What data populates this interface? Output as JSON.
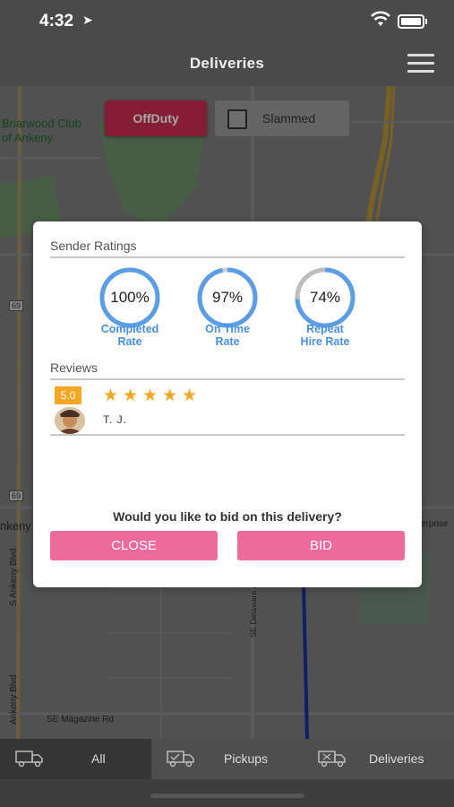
{
  "status": {
    "time": "4:32"
  },
  "header": {
    "title": "Deliveries"
  },
  "map": {
    "labels": {
      "club": "Briarwood Club\nof Ankeny",
      "ankeny": "nkeny",
      "ankeny_blvd_1": "S Ankeny Blvd",
      "ankeny_blvd_2": "Ankeny Blvd",
      "delaware": "SE Delaware Av",
      "magazine": "SE Magazine Rd",
      "enterprise": "erprise",
      "hwy_69_a": "69",
      "hwy_69_b": "69"
    }
  },
  "controls": {
    "offduty_label": "OffDuty",
    "slammed_label": "Slammed"
  },
  "modal": {
    "sender_ratings_title": "Sender Ratings",
    "ratings": [
      {
        "value": 100,
        "label": "100%",
        "caption_1": "Completed",
        "caption_2": "Rate"
      },
      {
        "value": 97,
        "label": "97%",
        "caption_1": "On Time",
        "caption_2": "Rate"
      },
      {
        "value": 74,
        "label": "74%",
        "caption_1": "Repeat",
        "caption_2": "Hire Rate"
      }
    ],
    "reviews_title": "Reviews",
    "review": {
      "score": "5.0",
      "stars": "★★★★★",
      "name": "T. J."
    },
    "question": "Would you like to bid on this delivery?",
    "close_label": "CLOSE",
    "bid_label": "BID"
  },
  "tabs": [
    {
      "label": "All",
      "icon": "truck-icon",
      "active": true
    },
    {
      "label": "Pickups",
      "icon": "pickup-truck-icon",
      "active": false
    },
    {
      "label": "Deliveries",
      "icon": "delivery-truck-icon",
      "active": false
    }
  ],
  "colors": {
    "offduty": "#cc2d50",
    "accent_blue": "#4a90e2",
    "button_pink": "#ee6a9a",
    "star": "#f5a623"
  }
}
